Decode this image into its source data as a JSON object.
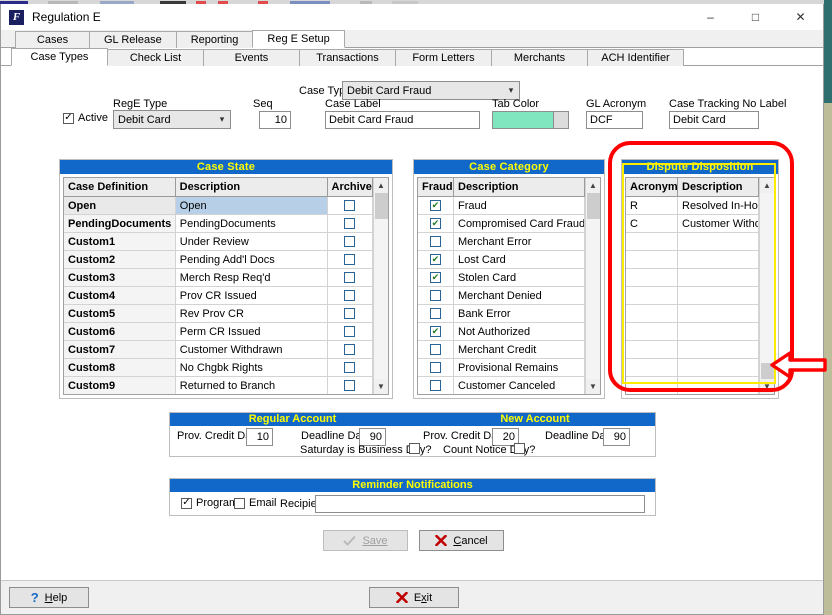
{
  "window": {
    "title": "Regulation E",
    "app_icon": "F",
    "icon_name": "app-icon-f",
    "controls": {
      "minimize": "–",
      "maximize": "□",
      "close": "✕"
    }
  },
  "tabs_outer": [
    {
      "label": "Cases",
      "active": false
    },
    {
      "label": "GL Release",
      "active": false
    },
    {
      "label": "Reporting",
      "active": false
    },
    {
      "label": "Reg E Setup",
      "active": true
    }
  ],
  "tabs_inner": [
    {
      "label": "Case Types",
      "active": true
    },
    {
      "label": "Check List",
      "active": false
    },
    {
      "label": "Events",
      "active": false
    },
    {
      "label": "Transactions",
      "active": false
    },
    {
      "label": "Form Letters",
      "active": false
    },
    {
      "label": "Merchants",
      "active": false
    },
    {
      "label": "ACH Identifier",
      "active": false
    }
  ],
  "form": {
    "case_type_label": "Case Type",
    "case_type_value": "Debit Card Fraud",
    "active_label": "Active",
    "active_checked": true,
    "rege_type_label": "RegE Type",
    "rege_type_value": "Debit Card",
    "seq_label": "Seq",
    "seq_value": "10",
    "case_label_label": "Case Label",
    "case_label_value": "Debit Card Fraud",
    "tab_color_label": "Tab Color",
    "tab_color_value": "#7FE6C0",
    "gl_acronym_label": "GL Acronym",
    "gl_acronym_value": "DCF",
    "case_tracking_label": "Case Tracking No Label",
    "case_tracking_value": "Debit Card"
  },
  "case_state": {
    "title": "Case State",
    "columns": [
      "Case Definition",
      "Description",
      "Archive"
    ],
    "rows": [
      {
        "definition": "Open",
        "description": "Open",
        "archive": false,
        "selected": true
      },
      {
        "definition": "PendingDocuments",
        "description": "PendingDocuments",
        "archive": false,
        "selected": false
      },
      {
        "definition": "Custom1",
        "description": "Under Review",
        "archive": false,
        "selected": false
      },
      {
        "definition": "Custom2",
        "description": "Pending Add'l Docs",
        "archive": false,
        "selected": false
      },
      {
        "definition": "Custom3",
        "description": "Merch Resp Req'd",
        "archive": false,
        "selected": false
      },
      {
        "definition": "Custom4",
        "description": "Prov CR Issued",
        "archive": false,
        "selected": false
      },
      {
        "definition": "Custom5",
        "description": "Rev Prov CR",
        "archive": false,
        "selected": false
      },
      {
        "definition": "Custom6",
        "description": "Perm CR Issued",
        "archive": false,
        "selected": false
      },
      {
        "definition": "Custom7",
        "description": "Customer Withdrawn",
        "archive": false,
        "selected": false
      },
      {
        "definition": "Custom8",
        "description": "No Chgbk Rights",
        "archive": false,
        "selected": false
      },
      {
        "definition": "Custom9",
        "description": "Returned to Branch",
        "archive": false,
        "selected": false
      }
    ]
  },
  "case_category": {
    "title": "Case Category",
    "columns": [
      "Fraud",
      "Description"
    ],
    "rows": [
      {
        "fraud": true,
        "description": "Fraud"
      },
      {
        "fraud": true,
        "description": "Compromised Card Fraud"
      },
      {
        "fraud": false,
        "description": "Merchant Error"
      },
      {
        "fraud": true,
        "description": "Lost Card"
      },
      {
        "fraud": true,
        "description": "Stolen Card"
      },
      {
        "fraud": false,
        "description": "Merchant Denied"
      },
      {
        "fraud": false,
        "description": "Bank Error"
      },
      {
        "fraud": true,
        "description": "Not Authorized"
      },
      {
        "fraud": false,
        "description": "Merchant Credit"
      },
      {
        "fraud": false,
        "description": "Provisional Remains"
      },
      {
        "fraud": false,
        "description": "Customer Canceled"
      }
    ]
  },
  "dispute_disposition": {
    "title": "Dispute Disposition",
    "columns": [
      "Acronym",
      "Description"
    ],
    "rows": [
      {
        "acronym": "R",
        "description": "Resolved In-House"
      },
      {
        "acronym": "C",
        "description": "Customer Withdrawn"
      },
      {
        "acronym": "",
        "description": ""
      },
      {
        "acronym": "",
        "description": ""
      },
      {
        "acronym": "",
        "description": ""
      },
      {
        "acronym": "",
        "description": ""
      },
      {
        "acronym": "",
        "description": ""
      },
      {
        "acronym": "",
        "description": ""
      },
      {
        "acronym": "",
        "description": ""
      },
      {
        "acronym": "",
        "description": ""
      },
      {
        "acronym": "",
        "description": ""
      }
    ],
    "highlight_color": "#FE0000",
    "focus_color": "#FFEC00"
  },
  "regular_account": {
    "title": "Regular Account",
    "prov_credit_days_label": "Prov. Credit Days",
    "prov_credit_days_value": "10",
    "deadline_days_label": "Deadline Days",
    "deadline_days_value": "90",
    "saturday_label": "Saturday is Business Day?",
    "saturday_checked": false
  },
  "new_account": {
    "title": "New Account",
    "prov_credit_days_label": "Prov. Credit Days",
    "prov_credit_days_value": "20",
    "deadline_days_label": "Deadline Days",
    "deadline_days_value": "90",
    "count_notice_label": "Count Notice Day?",
    "count_notice_checked": false
  },
  "reminder": {
    "title": "Reminder Notifications",
    "program_label": "Program",
    "program_checked": true,
    "email_label": "Email",
    "email_checked": false,
    "recipients_label": "Recipients",
    "recipients_value": "",
    "recipients_placeholder": ""
  },
  "actions": {
    "save_label": "Save",
    "save_enabled": false,
    "cancel_label": "Cancel",
    "help_label": "Help",
    "exit_label": "Exit"
  }
}
